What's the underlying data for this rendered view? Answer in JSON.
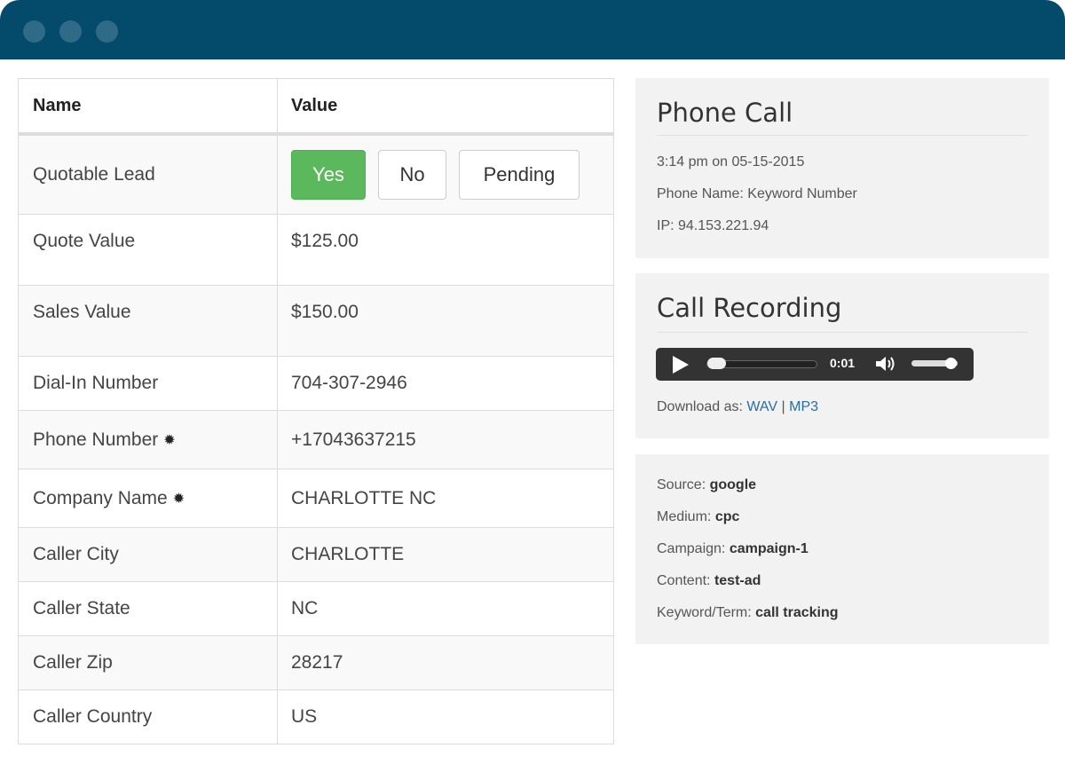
{
  "table": {
    "headers": {
      "name": "Name",
      "value": "Value"
    },
    "quotable_lead": {
      "label": "Quotable Lead",
      "yes": "Yes",
      "no": "No",
      "pending": "Pending",
      "selected": "Yes"
    },
    "rows": [
      {
        "label": "Quote Value",
        "value": "$125.00"
      },
      {
        "label": "Sales Value",
        "value": "$150.00"
      },
      {
        "label": "Dial-In Number",
        "value": "704-307-2946"
      },
      {
        "label": "Phone Number",
        "value": "+17043637215",
        "star": "✹"
      },
      {
        "label": "Company Name",
        "value": "CHARLOTTE NC",
        "star": "✹"
      },
      {
        "label": "Caller City",
        "value": "CHARLOTTE"
      },
      {
        "label": "Caller State",
        "value": "NC"
      },
      {
        "label": "Caller Zip",
        "value": "28217"
      },
      {
        "label": "Caller Country",
        "value": "US"
      }
    ]
  },
  "phone_call": {
    "title": "Phone Call",
    "timestamp": "3:14 pm on 05-15-2015",
    "phone_name": "Phone Name: Keyword Number",
    "ip": "IP: 94.153.221.94"
  },
  "call_recording": {
    "title": "Call Recording",
    "time": "0:01",
    "download_label": "Download as:",
    "wav": "WAV",
    "separator": "|",
    "mp3": "MP3"
  },
  "attribution": {
    "source_label": "Source:",
    "source": "google",
    "medium_label": "Medium:",
    "medium": "cpc",
    "campaign_label": "Campaign:",
    "campaign": "campaign-1",
    "content_label": "Content:",
    "content": "test-ad",
    "keyword_label": "Keyword/Term:",
    "keyword": "call tracking"
  },
  "colors": {
    "titlebar": "#044a6b",
    "yes_button": "#5cb85c",
    "link": "#2a6fa0"
  }
}
